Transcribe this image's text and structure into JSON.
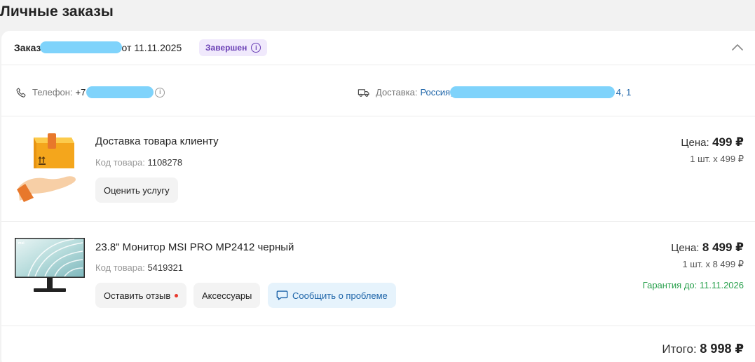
{
  "page": {
    "title": "Личные заказы"
  },
  "order": {
    "label": "Заказ",
    "date_text": "от 11.11.2025",
    "status": "Завершен",
    "status_color": "#6a3fb5",
    "collapse_icon": "chevron-up-icon"
  },
  "contact": {
    "phone_label": "Телефон:",
    "phone_prefix": "+7",
    "delivery_label": "Доставка:",
    "delivery_start": "Россия,",
    "delivery_end": "4, 1"
  },
  "items": [
    {
      "name": "Доставка товара клиенту",
      "code_label": "Код товара:",
      "code": "1108278",
      "price_label": "Цена:",
      "price": "499 ₽",
      "qty": "1 шт. х 499 ₽",
      "rate_button": "Оценить услугу",
      "image_icon": "delivery-box-hand-icon"
    },
    {
      "name": "23.8\" Монитор MSI PRO MP2412 черный",
      "code_label": "Код товара:",
      "code": "5419321",
      "price_label": "Цена:",
      "price": "8 499 ₽",
      "qty": "1 шт. х 8 499 ₽",
      "warranty": "Гарантия до: 11.11.2026",
      "review_button": "Оставить отзыв",
      "accessories_button": "Аксессуары",
      "problem_button": "Сообщить о проблеме",
      "image_icon": "monitor-msi-icon",
      "warranty_color": "#2aa14e"
    }
  ],
  "total": {
    "label": "Итого:",
    "value": "8 998 ₽"
  }
}
